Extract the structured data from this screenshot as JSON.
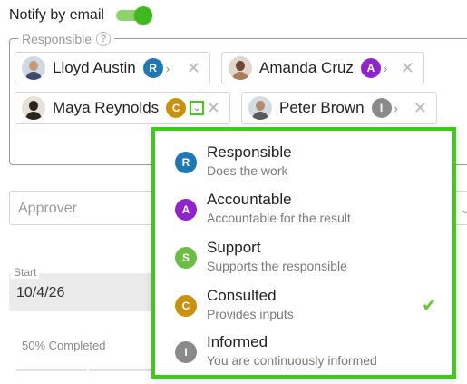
{
  "notify": {
    "label": "Notify by email",
    "enabled": true
  },
  "responsible": {
    "legend": "Responsible",
    "help_glyph": "?",
    "chips": [
      {
        "name": "Lloyd Austin",
        "role_letter": "R",
        "role_color": "#1f78b4"
      },
      {
        "name": "Amanda Cruz",
        "role_letter": "A",
        "role_color": "#8e24c9"
      },
      {
        "name": "Maya Reynolds",
        "role_letter": "C",
        "role_color": "#c9920e"
      },
      {
        "name": "Peter Brown",
        "role_letter": "I",
        "role_color": "#8a8a8a"
      }
    ]
  },
  "approver": {
    "placeholder": "Approver"
  },
  "start": {
    "label": "Start",
    "value": "10/4/26"
  },
  "progress": {
    "label": "50% Completed",
    "percent": 50
  },
  "role_menu": {
    "options": [
      {
        "letter": "R",
        "title": "Responsible",
        "desc": "Does the work",
        "color": "#1f78b4",
        "selected": false
      },
      {
        "letter": "A",
        "title": "Accountable",
        "desc": "Accountable for the result",
        "color": "#8e24c9",
        "selected": false
      },
      {
        "letter": "S",
        "title": "Support",
        "desc": "Supports the responsible",
        "color": "#6cbd45",
        "selected": false
      },
      {
        "letter": "C",
        "title": "Consulted",
        "desc": "Provides inputs",
        "color": "#c9920e",
        "selected": true
      },
      {
        "letter": "I",
        "title": "Informed",
        "desc": "You are continuously informed",
        "color": "#8a8a8a",
        "selected": false
      }
    ]
  }
}
